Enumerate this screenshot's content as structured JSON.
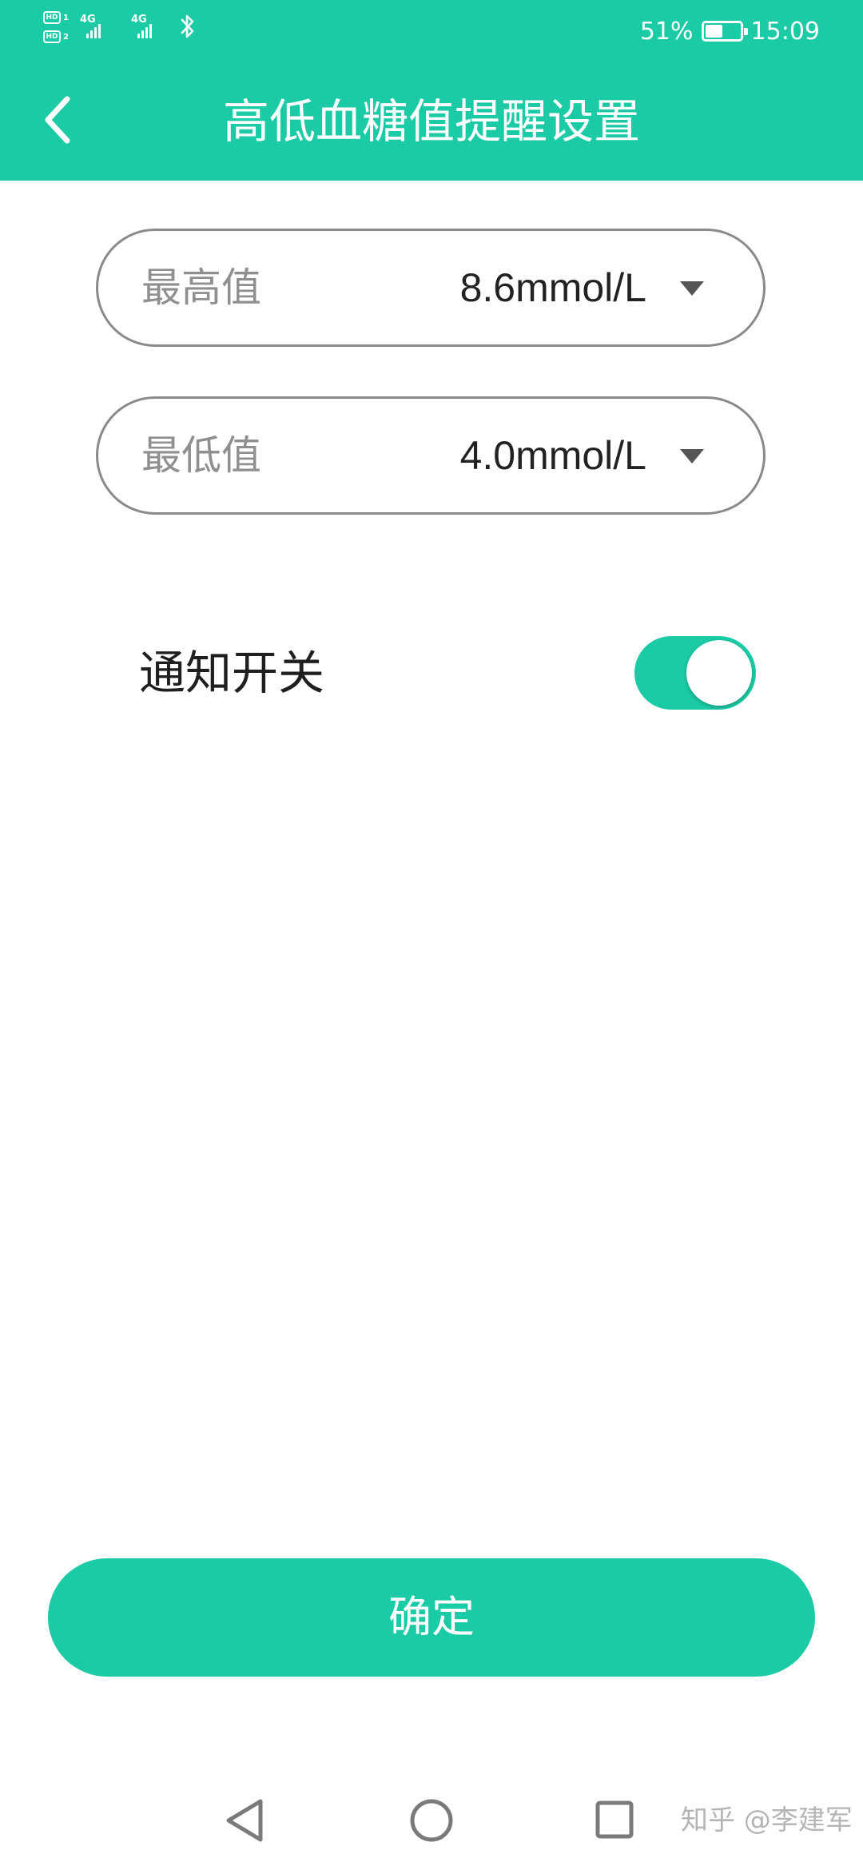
{
  "status_bar": {
    "hd_badge": "HD",
    "sim1": "1",
    "sim2": "2",
    "network1": "4G",
    "network2": "4G",
    "battery_percent_text": "51%",
    "battery_level": 0.51,
    "time": "15:09",
    "icons": [
      "hd-icon",
      "signal-icon",
      "signal-icon",
      "bluetooth-icon",
      "battery-icon"
    ]
  },
  "app_bar": {
    "back_icon": "chevron-left-icon",
    "title": "高低血糖值提醒设置"
  },
  "colors": {
    "accent": "#1bcba5",
    "pill_border": "#8a8a8e",
    "label_gray": "#8f8f8f",
    "value_text": "#222222"
  },
  "max_value": {
    "label": "最高值",
    "value": "8.6mmol/L",
    "icon": "triangle-down-icon"
  },
  "min_value": {
    "label": "最低值",
    "value": "4.0mmol/L",
    "icon": "triangle-down-icon"
  },
  "notification": {
    "label": "通知开关",
    "enabled": true
  },
  "confirm_button": {
    "label": "确定"
  },
  "system_nav": {
    "icons": [
      "back-triangle-icon",
      "home-circle-icon",
      "recent-square-icon"
    ]
  },
  "watermark": "知乎 @李建军"
}
